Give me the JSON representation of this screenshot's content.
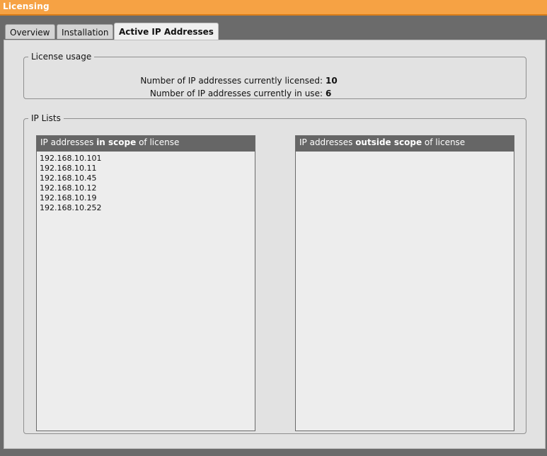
{
  "window": {
    "title": "Licensing"
  },
  "tabs": [
    {
      "label": "Overview",
      "active": false
    },
    {
      "label": "Installation",
      "active": false
    },
    {
      "label": "Active IP Addresses",
      "active": true
    }
  ],
  "license_usage": {
    "legend": "License usage",
    "licensed_label": "Number of IP addresses currently licensed:",
    "licensed_value": "10",
    "in_use_label": "Number of IP addresses currently in use:",
    "in_use_value": "6"
  },
  "ip_lists": {
    "legend": "IP Lists",
    "in_scope": {
      "head_prefix": "IP addresses ",
      "head_emphasis": "in scope",
      "head_suffix": " of license",
      "items": [
        "192.168.10.101",
        "192.168.10.11",
        "192.168.10.45",
        "192.168.10.12",
        "192.168.10.19",
        "192.168.10.252"
      ]
    },
    "outside_scope": {
      "head_prefix": "IP addresses ",
      "head_emphasis": "outside scope",
      "head_suffix": " of license",
      "items": []
    }
  },
  "colors": {
    "titlebar": "#f6a244",
    "background": "#6b6b6b",
    "panel_header": "#666666"
  }
}
